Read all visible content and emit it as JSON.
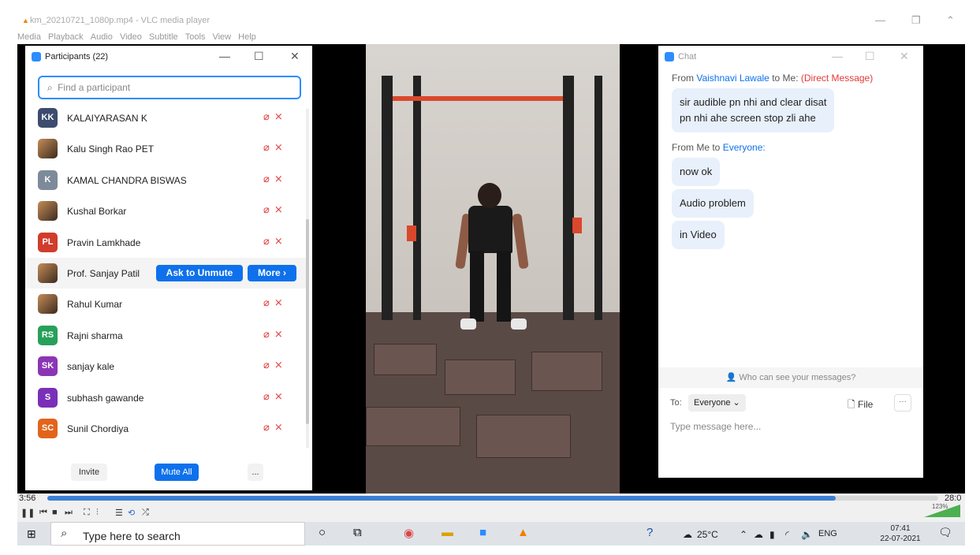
{
  "vlc": {
    "window_title": "km_20210721_1080p.mp4 - VLC media player",
    "menu": [
      "Media",
      "Playback",
      "Audio",
      "Video",
      "Subtitle",
      "Tools",
      "View",
      "Help"
    ],
    "time_current": "3:56",
    "time_total": "28:0",
    "progress_fraction": 0.885,
    "volume_label": "123%",
    "volume_fraction": 1.0
  },
  "participants": {
    "title": "Participants (22)",
    "search_placeholder": "Find a participant",
    "items": [
      {
        "initials": "KK",
        "name": "KALAIYARASAN K",
        "color": "#3d4b6e"
      },
      {
        "initials": "",
        "name": "Kalu Singh Rao PET",
        "photo": true
      },
      {
        "initials": "K",
        "name": "KAMAL CHANDRA BISWAS",
        "color": "#7d8a99"
      },
      {
        "initials": "",
        "name": "Kushal Borkar",
        "photo": true
      },
      {
        "initials": "PL",
        "name": "Pravin Lamkhade",
        "color": "#d13c2d"
      },
      {
        "initials": "",
        "name": "Prof. Sanjay Patil",
        "photo": true,
        "highlight": true
      },
      {
        "initials": "",
        "name": "Rahul Kumar",
        "photo": true
      },
      {
        "initials": "RS",
        "name": "Rajni sharma",
        "color": "#27a05a"
      },
      {
        "initials": "SK",
        "name": "sanjay kale",
        "color": "#8b35b5"
      },
      {
        "initials": "S",
        "name": "subhash gawande",
        "color": "#7a2fb8"
      },
      {
        "initials": "SC",
        "name": "Sunil Chordiya",
        "color": "#e2641b"
      }
    ],
    "ask_unmute_label": "Ask to Unmute",
    "more_label": "More ›",
    "invite_label": "Invite",
    "mute_all_label": "Mute All",
    "ellipsis_label": "...",
    "status_icons": "🎤̸ 📹̸"
  },
  "chat": {
    "title": "Chat",
    "msg1_from_prefix": "From ",
    "msg1_sender": "Vaishnavi Lawale",
    "msg1_to": " to Me: ",
    "msg1_tag": "(Direct Message)",
    "msg1_text_line1": "sir audible pn nhi and clear disat",
    "msg1_text_line2": "pn nhi ahe screen stop zli ahe",
    "msg2_from_prefix": "From Me to ",
    "msg2_target": "Everyone:",
    "bubbles": [
      "now ok",
      "Audio problem",
      "in Video"
    ],
    "who_can_see": "Who can see your messages?",
    "to_label": "To:",
    "to_value": "Everyone",
    "file_label": "File",
    "more_label": "···",
    "input_placeholder": "Type message here..."
  },
  "taskbar": {
    "search_text": "Type here to search",
    "temperature": "25°C",
    "language": "ENG",
    "time": "07:41",
    "date": "22-07-2021"
  }
}
